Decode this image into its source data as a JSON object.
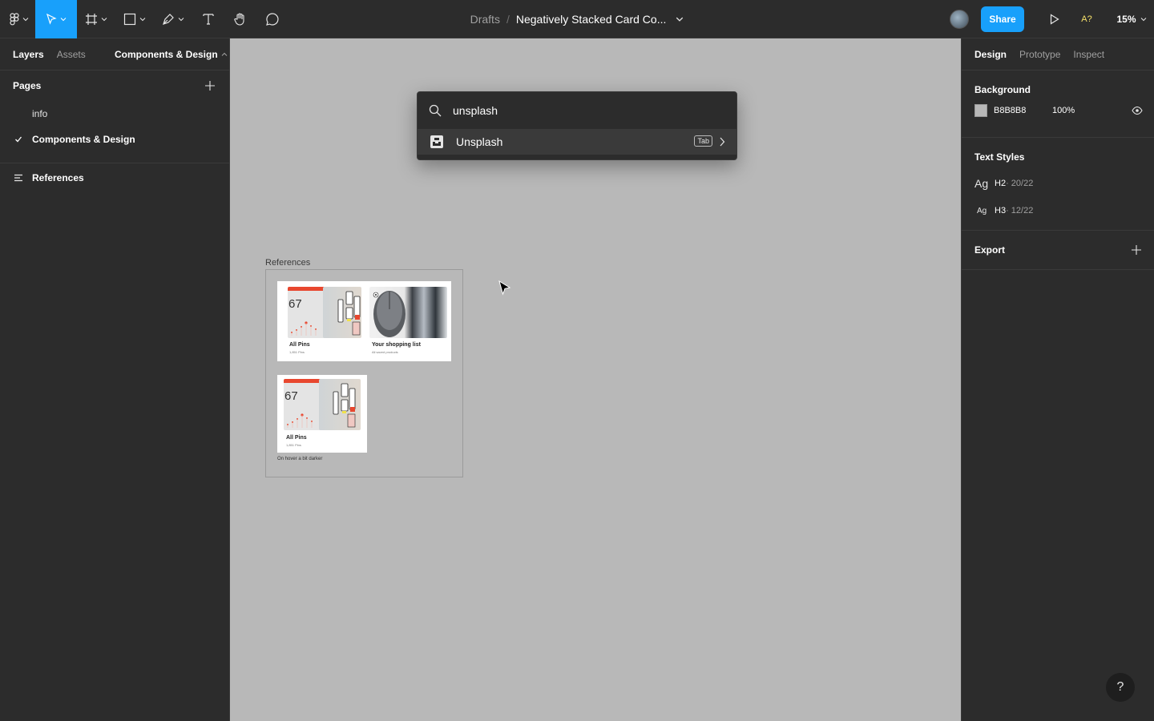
{
  "toolbar": {
    "breadcrumb": "Drafts",
    "separator": "/",
    "doc_title": "Negatively Stacked Card Co...",
    "share_label": "Share",
    "a11y_label": "A?",
    "zoom": "15%"
  },
  "left_panel": {
    "tabs": [
      "Layers",
      "Assets"
    ],
    "page_switch": "Components & Design",
    "pages_title": "Pages",
    "pages": [
      {
        "label": "info",
        "current": false
      },
      {
        "label": "Components & Design",
        "current": true
      }
    ],
    "layers": [
      {
        "label": "References"
      }
    ]
  },
  "right_panel": {
    "tabs": [
      "Design",
      "Prototype",
      "Inspect"
    ],
    "background": {
      "title": "Background",
      "hex": "B8B8B8",
      "opacity": "100%"
    },
    "text_styles": {
      "title": "Text Styles",
      "items": [
        {
          "ag": "Ag",
          "name": "H2",
          "spec": " · 20/22"
        },
        {
          "ag": "Ag",
          "name": "H3",
          "spec": " · 12/22"
        }
      ]
    },
    "export_title": "Export"
  },
  "canvas": {
    "frame_label": "References",
    "cards": [
      {
        "number": "67",
        "title": "All Pins",
        "sub": "1,851 Pins"
      },
      {
        "title": "Your shopping list",
        "sub": "All saved products"
      },
      {
        "number": "67",
        "title": "All Pins",
        "sub": "1,851 Pins"
      }
    ],
    "hover_note": "On hover a bit darker"
  },
  "palette": {
    "query": "unsplash",
    "result_label": "Unsplash",
    "tab_key": "Tab"
  },
  "help_label": "?",
  "colors": {
    "accent": "#18a0fb",
    "panel": "#2c2c2c",
    "canvas": "#b8b8b8"
  }
}
